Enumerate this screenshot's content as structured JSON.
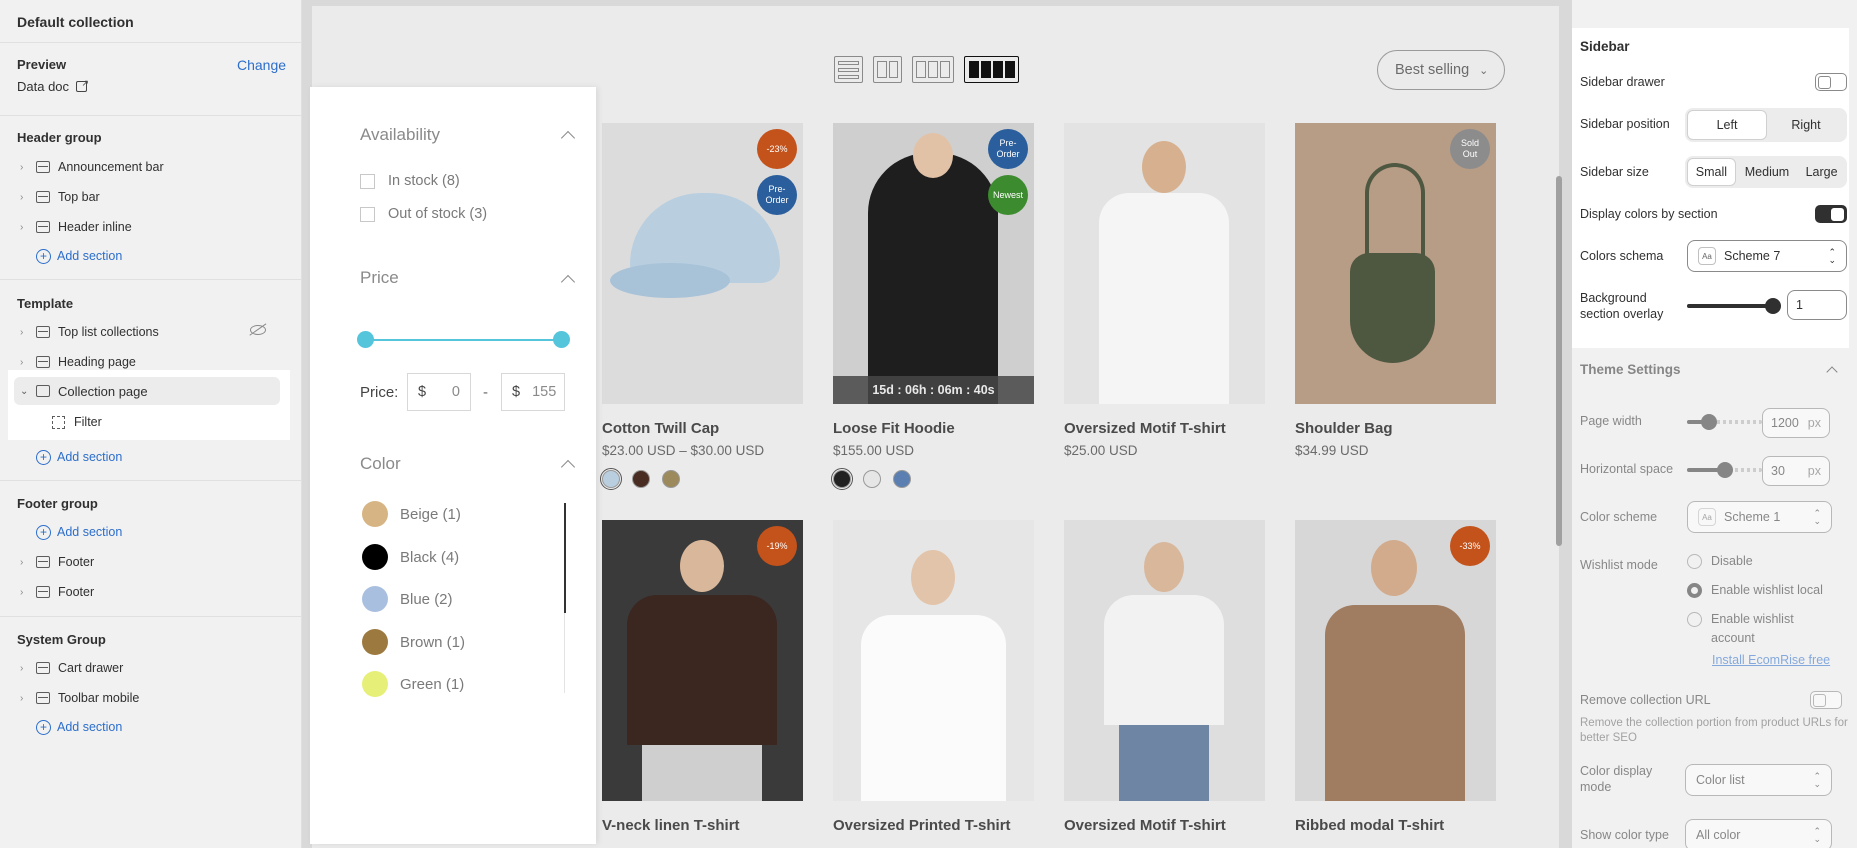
{
  "left": {
    "title": "Default collection",
    "preview_label": "Preview",
    "change_label": "Change",
    "preview_value": "Data doc",
    "header_group": "Header group",
    "header_items": [
      "Announcement bar",
      "Top bar",
      "Header inline"
    ],
    "add_section": "Add section",
    "template": "Template",
    "template_items": [
      "Top list collections",
      "Heading page"
    ],
    "collection_page": "Collection page",
    "filter": "Filter",
    "footer_group": "Footer group",
    "footer_items": [
      "Footer",
      "Footer"
    ],
    "system_group": "System Group",
    "system_items": [
      "Cart drawer",
      "Toolbar mobile"
    ]
  },
  "preview": {
    "sort": "Best selling",
    "products": [
      {
        "name": "Cotton Twill Cap",
        "price": "$23.00 USD – $30.00 USD",
        "badges": [
          "-23%",
          "Pre-\nOrder"
        ]
      },
      {
        "name": "Loose Fit Hoodie",
        "price": "$155.00 USD",
        "badges": [
          "Pre-\nOrder",
          "Newest"
        ],
        "countdown": "15d : 06h : 06m : 40s"
      },
      {
        "name": "Oversized Motif T-shirt",
        "price": "$25.00 USD",
        "badges": []
      },
      {
        "name": "Shoulder Bag",
        "price": "$34.99 USD",
        "badges": [
          "Sold\nOut"
        ]
      },
      {
        "name": "V-neck linen T-shirt",
        "price": "",
        "badges": [
          "-19%"
        ]
      },
      {
        "name": "Oversized Printed T-shirt",
        "price": "",
        "badges": []
      },
      {
        "name": "Oversized Motif T-shirt",
        "price": "",
        "badges": []
      },
      {
        "name": "Ribbed modal T-shirt",
        "price": "",
        "badges": [
          "-33%"
        ]
      }
    ]
  },
  "filter": {
    "availability": "Availability",
    "in_stock": "In stock (8)",
    "out_of_stock": "Out of stock (3)",
    "price_heading": "Price",
    "price_label": "Price:",
    "currency": "$",
    "min": "0",
    "max": "155",
    "dash": "-",
    "color_heading": "Color",
    "colors": [
      {
        "label": "Beige (1)",
        "color": "#d6b483"
      },
      {
        "label": "Black (4)",
        "color": "#000000"
      },
      {
        "label": "Blue (2)",
        "color": "#a9bfe0"
      },
      {
        "label": "Brown (1)",
        "color": "#9c7a3f"
      },
      {
        "label": "Green (1)",
        "color": "#e6ef78"
      }
    ]
  },
  "right": {
    "sidebar_title": "Sidebar",
    "sidebar_drawer": "Sidebar drawer",
    "sidebar_position": "Sidebar position",
    "pos_left": "Left",
    "pos_right": "Right",
    "sidebar_size": "Sidebar size",
    "size_small": "Small",
    "size_medium": "Medium",
    "size_large": "Large",
    "display_colors": "Display colors by section",
    "colors_schema": "Colors schema",
    "scheme7": "Scheme 7",
    "bg_overlay": "Background section overlay",
    "bg_overlay_value": "1",
    "theme_settings": "Theme Settings",
    "page_width": "Page width",
    "page_width_value": "1200",
    "px": "px",
    "horizontal_space": "Horizontal space",
    "horizontal_space_value": "30",
    "color_scheme": "Color scheme",
    "scheme1": "Scheme 1",
    "wishlist_mode": "Wishlist mode",
    "wl_disable": "Disable",
    "wl_local": "Enable wishlist local",
    "wl_account": "Enable wishlist account",
    "install_link": "Install EcomRise free",
    "remove_url": "Remove collection URL",
    "remove_help": "Remove the collection portion from product URLs for better SEO",
    "color_display_mode": "Color display mode",
    "color_list": "Color list",
    "show_color_type": "Show color type",
    "all_color": "All color"
  }
}
